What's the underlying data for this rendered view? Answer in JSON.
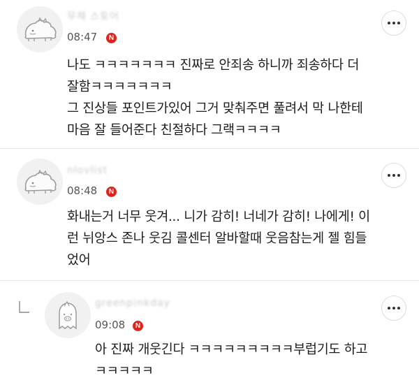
{
  "comments": [
    {
      "username": "무제 스토어",
      "time": "08:47",
      "badge": "N",
      "lines": [
        "나도 ㅋㅋㅋㅋㅋㅋㅋ 진짜로 안죄송 하니까 죄송하다 더",
        "잘함ㅋㅋㅋㅋㅋㅋㅋ",
        "그 진상들 포인트가있어 그거 맞춰주면 풀려서 막 나한테",
        "마음 잘 들어준다 친절하다 그랙ㅋㅋㅋㅋ"
      ]
    },
    {
      "username": "nlovlist",
      "time": "08:48",
      "badge": "N",
      "lines": [
        "화내는거 너무 웃겨... 니가 감히! 너네가 감히! 나에게! 이",
        "런 뉘앙스 존나 웃김 콜센터 알바할때 웃음참는게 젤 힘들",
        "었어"
      ]
    },
    {
      "username": "greenpinkday",
      "time": "09:08",
      "badge": "N",
      "lines": [
        "아 진짜 개웃긴다 ㅋㅋㅋㅋㅋㅋㅋㅋㅋ부럽기도 하고",
        "ㅋㅋㅋㅋㅋ"
      ]
    }
  ],
  "colors": {
    "badge": "#e2231a",
    "divider": "#e6e6e6",
    "time": "#555555"
  },
  "icons": {
    "avatar_1": "dino-avatar-icon",
    "avatar_2": "dino-avatar-icon",
    "avatar_3": "ghost-avatar-icon",
    "more": "more-dots-icon",
    "reply": "reply-arrow-icon"
  }
}
